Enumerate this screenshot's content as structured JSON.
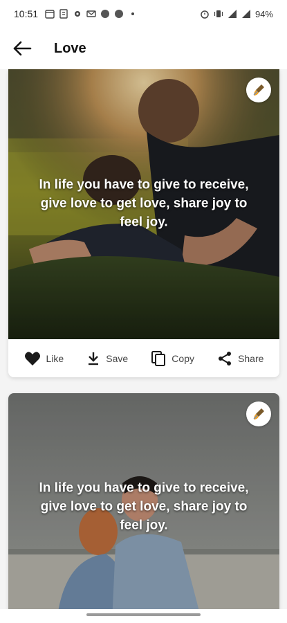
{
  "status_bar": {
    "time": "10:51",
    "battery": "94%"
  },
  "app_bar": {
    "title": "Love",
    "back_icon": "arrow-left-icon"
  },
  "cards": [
    {
      "quote": "In life you have to give to receive, give love to get love, share joy to feel joy.",
      "edit_icon": "brush-icon",
      "actions": {
        "like_label": "Like",
        "save_label": "Save",
        "copy_label": "Copy",
        "share_label": "Share"
      }
    },
    {
      "quote": "In life you have to give to receive, give love to get love, share joy to feel joy.",
      "edit_icon": "brush-icon"
    }
  ],
  "colors": {
    "accent_orange": "#f2a428",
    "text_white": "#ffffff",
    "icon_dark": "#1a1a1a"
  }
}
